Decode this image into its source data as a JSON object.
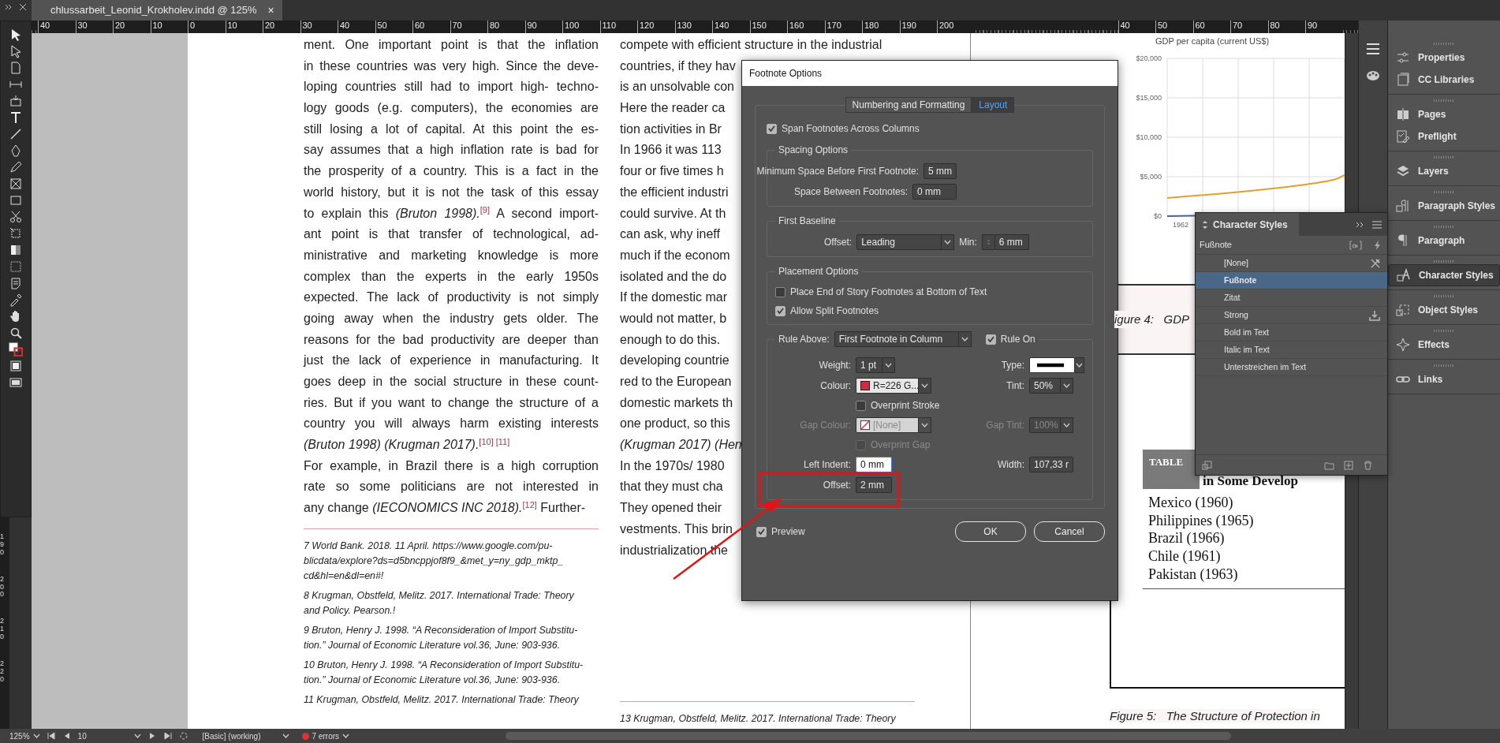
{
  "document_tab": {
    "title": "chlussarbeit_Leonid_Krokholev.indd @ 125%",
    "close": "×"
  },
  "ruler": {
    "page_1": [
      "40",
      "30",
      "20",
      "10",
      "0",
      "10",
      "20",
      "30",
      "40",
      "50",
      "60",
      "70",
      "80",
      "90",
      "100",
      "110",
      "120",
      "130",
      "140",
      "150",
      "160",
      "170",
      "180",
      "190",
      "200"
    ],
    "page_2": [
      "40",
      "50",
      "60",
      "70",
      "80",
      "90"
    ],
    "vertical": [
      "190",
      "200",
      "210",
      "220"
    ]
  },
  "left_column": {
    "paragraphs": [
      {
        "lines": [
          "ment. One important point is that the inflation",
          "in these countries was very high. Since the deve-",
          "loping countries still had to import high- techno-",
          "logy goods (e.g. computers), the economies are",
          "still losing a lot of capital. At this point the es-",
          "say assumes that a high inflation rate is bad for",
          "the prosperity of a country. This is a fact in the",
          "world history, but it is not the task of this essay",
          "to explain this *(Bruton 1998).*$^{[9]}$ A second import-",
          "ant point is that transfer of technological, ad-",
          "ministrative and marketing knowledge is more",
          "complex than the experts in the early 1950s",
          "expected. The lack of productivity is not simply",
          "going away when the industry gets older. The",
          "reasons for the bad productivity are deeper than",
          "just the lack of experience in manufacturing. It",
          "goes deep in the social structure in these count-",
          "ries. But if you want to change the structure of a",
          "country you will always harm existing interests",
          "*(Bruton 1998) (Krugman 2017).*$^{[10] [11]}$"
        ]
      },
      {
        "lines": [
          "For example, in Brazil there is a high corruption",
          "rate so some politicians are not interested in",
          "any change *(IECONOMICS INC 2018).*$^{[12]}$ Further-"
        ]
      }
    ],
    "footnotes": [
      {
        "lines": [
          "7 World Bank. 2018. 11 April. https://www.google.com/pu-",
          "blicdata/explore?ds=d5bncppjof8f9_&met_y=ny_gdp_mktp_",
          "cd&hl=en&dl=en#!"
        ]
      },
      {
        "lines": [
          "8 Krugman, Obstfeld, Melitz. 2017. International Trade: Theory",
          "and Policy. Pearson.!"
        ]
      },
      {
        "lines": [
          "9 Bruton, Henry J. 1998. “A Reconsideration of Import Substitu-",
          "tion.” Journal of Economic Literature vol.36, June: 903-936."
        ]
      },
      {
        "lines": [
          "10 Bruton, Henry J. 1998. “A Reconsideration of Import Substitu-",
          "tion.” Journal of Economic Literature vol.36, June: 903-936."
        ]
      },
      {
        "lines": [
          "11 Krugman, Obstfeld, Melitz. 2017. International Trade: Theory"
        ]
      }
    ]
  },
  "middle_column": {
    "lines": [
      "compete with efficient structure in the industrial",
      "countries, if they hav",
      "is an unsolvable con",
      "Here the reader ca",
      "tion activities in Br",
      "In 1966 it was 113",
      "four or five times h",
      "the efficient industri",
      "could survive. At th",
      "can ask, why ineff",
      "much if the econom",
      "isolated and the do",
      "If the domestic mar",
      "would not matter, b",
      "enough to do this.",
      "developing countrie",
      "red to the European",
      "domestic markets th",
      "one product, so this",
      "*(Krugman 2017) (Hen*",
      "In the 1970s/ 1980",
      "that they must cha",
      "They opened their",
      "vestments. This brin",
      "industrialization the"
    ],
    "footnotes": [
      {
        "lines": [
          "13 Krugman, Obstfeld, Melitz. 2017. International Trade: Theory"
        ]
      }
    ]
  },
  "right_page": {
    "chart": {
      "title": "GDP per capita (current US$)",
      "y_labels": [
        "$20,000",
        "$15,000",
        "$10,000",
        "$5,000",
        "$0"
      ],
      "x_label": "1962"
    },
    "figure_4": "igure 4:   GDP",
    "table": {
      "tag": "TABLE",
      "title_lines": [
        "in Some Develop"
      ],
      "rows": [
        "Mexico (1960)",
        "Philippines (1965)",
        "Brazil (1966)",
        "Chile (1961)",
        "Pakistan (1963)"
      ]
    },
    "figure_5": "Figure 5:   The Structure of Protection in"
  },
  "dialog": {
    "title": "Footnote Options",
    "tabs": [
      {
        "label": "Numbering and Formatting",
        "selected": false
      },
      {
        "label": "Layout",
        "selected": true
      }
    ],
    "span_footnotes": {
      "label": "Span Footnotes Across Columns",
      "checked": true
    },
    "spacing": {
      "title": "Spacing Options",
      "fields": [
        {
          "label": "Minimum Space Before First Footnote:",
          "value": "5 mm"
        },
        {
          "label": "Space Between Footnotes:",
          "value": "0 mm"
        }
      ]
    },
    "first_baseline": {
      "title": "First Baseline",
      "offset_label": "Offset:",
      "offset_value": "Leading",
      "min_label": "Min:",
      "min_value": "6 mm"
    },
    "placement": {
      "title": "Placement Options",
      "options": [
        {
          "label": "Place End of Story Footnotes at Bottom of Text",
          "checked": false
        },
        {
          "label": "Allow Split Footnotes",
          "checked": true
        }
      ]
    },
    "rule": {
      "label": "Rule Above:",
      "value": "First Footnote in Column",
      "rule_on": {
        "label": "Rule On",
        "checked": true
      },
      "rows": [
        {
          "left": {
            "kind": "select",
            "label": "Weight:",
            "value": "1 pt",
            "disabled": false
          },
          "right": {
            "kind": "line-select",
            "label": "Type:",
            "disabled": false
          }
        },
        {
          "left": {
            "kind": "swatch",
            "label": "Colour:",
            "value": "R=226 G...",
            "color": "#d42a40",
            "disabled": false
          },
          "right": {
            "kind": "select",
            "label": "Tint:",
            "value": "50%",
            "disabled": false
          }
        },
        {
          "left": {
            "kind": "checkbox",
            "label": "Overprint Stroke",
            "checked": false,
            "disabled": false
          }
        },
        {
          "left": {
            "kind": "none-swatch",
            "label": "Gap Colour:",
            "value": "[None]",
            "disabled": true
          },
          "right": {
            "kind": "select",
            "label": "Gap Tint:",
            "value": "100%",
            "disabled": true
          }
        },
        {
          "left": {
            "kind": "checkbox",
            "label": "Overprint Gap",
            "checked": false,
            "disabled": true
          }
        },
        {
          "left": {
            "kind": "input",
            "label": "Left Indent:",
            "value": "0 mm",
            "focused": true
          },
          "right": {
            "kind": "input",
            "label": "Width:",
            "value": "107,33 r",
            "focused": false
          }
        },
        {
          "left": {
            "kind": "input",
            "label": "Offset:",
            "value": "2 mm",
            "focused": false
          }
        }
      ]
    },
    "preview": {
      "label": "Preview",
      "checked": true
    },
    "buttons": [
      "OK",
      "Cancel"
    ]
  },
  "character_styles": {
    "title": "Character Styles",
    "current": "Fußnote",
    "items": [
      {
        "label": "[None]",
        "selected": false,
        "kind": "locked"
      },
      {
        "label": "Fußnote",
        "selected": true,
        "kind": "plain"
      },
      {
        "label": "Zitat",
        "selected": false,
        "kind": "plain"
      },
      {
        "label": "Strong",
        "selected": false,
        "kind": "imported"
      },
      {
        "label": "Bold im Text",
        "selected": false,
        "kind": "plain"
      },
      {
        "label": "Italic im Text",
        "selected": false,
        "kind": "plain"
      },
      {
        "label": "Unterstreichen im Text",
        "selected": false,
        "kind": "plain"
      }
    ]
  },
  "panels": {
    "groups": [
      [
        {
          "label": "Properties",
          "selected": false
        },
        {
          "label": "CC Libraries",
          "selected": false
        }
      ],
      [
        {
          "label": "Pages",
          "selected": false
        },
        {
          "label": "Preflight",
          "selected": false
        }
      ],
      [
        {
          "label": "Layers",
          "selected": false
        }
      ],
      [
        {
          "label": "Paragraph Styles",
          "selected": false
        }
      ],
      [
        {
          "label": "Paragraph",
          "selected": false
        }
      ],
      [
        {
          "label": "Character Styles",
          "selected": true
        }
      ],
      [
        {
          "label": "Object Styles",
          "selected": false
        }
      ],
      [
        {
          "label": "Effects",
          "selected": false
        }
      ],
      [
        {
          "label": "Links",
          "selected": false
        }
      ]
    ]
  },
  "status_bar": {
    "zoom": "125%",
    "page": "10",
    "style": "[Basic] (working)",
    "errors": "7 errors"
  }
}
